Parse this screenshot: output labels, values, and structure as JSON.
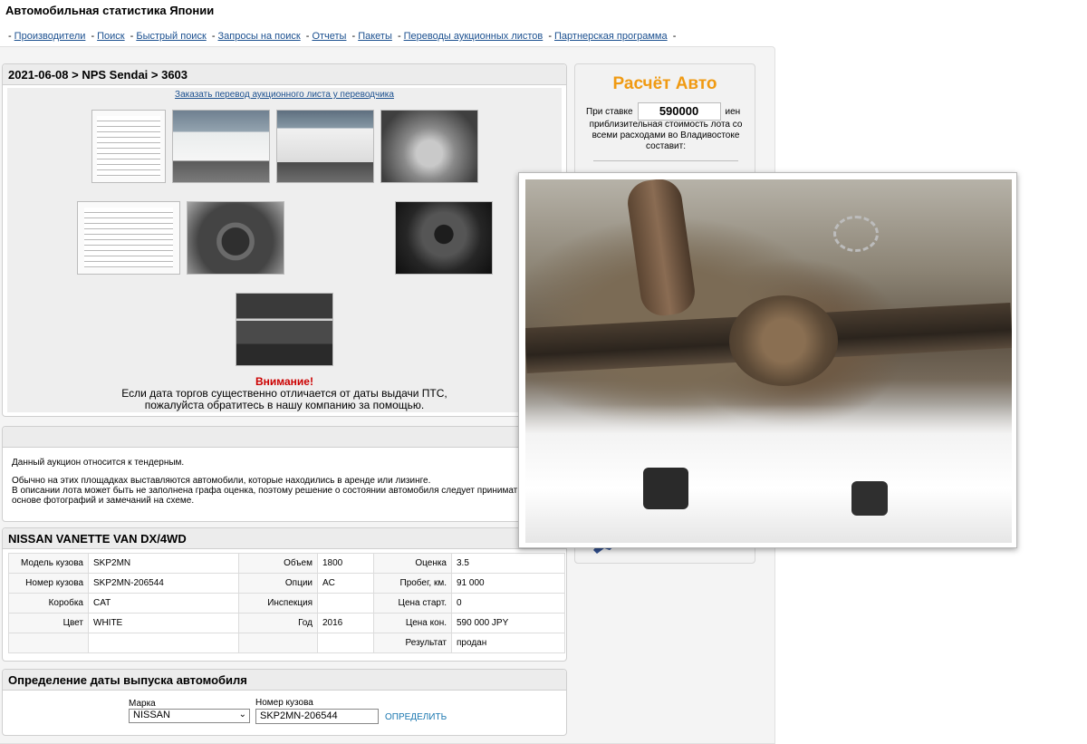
{
  "site_title": "Автомобильная статистика Японии",
  "nav": {
    "items": [
      "Производители",
      "Поиск",
      "Быстрый поиск",
      "Запросы на поиск",
      "Отчеты",
      "Пакеты",
      "Переводы аукционных листов",
      "Партнерская программа"
    ]
  },
  "lot": {
    "header": "2021-06-08 > NPS Sendai > 3603",
    "order_translation": "Заказать перевод аукционного листа у переводчика",
    "attention_title": "Внимание!",
    "attention_line1": "Если дата торгов существенно отличается от даты выдачи ПТС,",
    "attention_line2": "пожалуйста обратитесь в нашу компанию за помощью."
  },
  "calc": {
    "title": "Расчёт Авто",
    "bid_label": "При ставке",
    "bid_value": "590000",
    "currency": "иен",
    "description": "приблизительная стоимость лота со всеми расходами во Владивостоке составит:"
  },
  "tender": {
    "line1": "Данный аукцион относится к тендерным.",
    "line2": "Обычно на этих площадках выставляются автомобили, которые находились в аренде или лизинге.",
    "line3": "В описании лота может быть не заполнена графа оценка, поэтому решение о состоянии автомобиля следует принимат",
    "line4": "основе фотографий и замечаний на схеме."
  },
  "car": {
    "title": "NISSAN VANETTE VAN DX/4WD",
    "rows": [
      [
        "Модель кузова",
        "SKP2MN",
        "Объем",
        "1800",
        "Оценка",
        "3.5"
      ],
      [
        "Номер кузова",
        "SKP2MN-206544",
        "Опции",
        "AC",
        "Пробег, км.",
        "91 000"
      ],
      [
        "Коробка",
        "CAT",
        "Инспекция",
        "",
        "Цена старт.",
        "0"
      ],
      [
        "Цвет",
        "WHITE",
        "Год",
        "2016",
        "Цена кон.",
        "590 000 JPY"
      ],
      [
        "",
        "",
        "",
        "",
        "Результат",
        "продан"
      ]
    ]
  },
  "year": {
    "title": "Определение даты выпуска автомобиля",
    "make_label": "Марка",
    "make_value": "NISSAN",
    "body_label": "Номер кузова",
    "body_value": "SKP2MN-206544",
    "submit_label": "ОПРЕДЕЛИТЬ"
  }
}
